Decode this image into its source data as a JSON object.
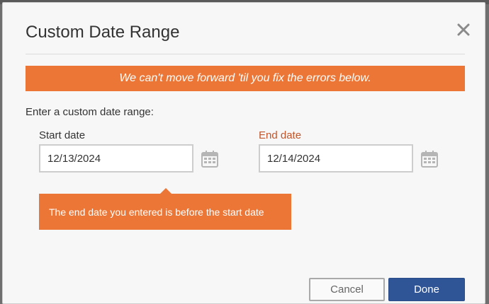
{
  "dialog": {
    "title": "Custom Date Range",
    "close_icon": "close-x-icon"
  },
  "error_banner": {
    "message": "We can't move forward 'til you fix the errors below."
  },
  "form": {
    "prompt": "Enter a custom date range:",
    "start": {
      "label": "Start date",
      "value": "12/13/2024",
      "icon": "calendar-icon"
    },
    "end": {
      "label": "End date",
      "value": "12/14/2024",
      "icon": "calendar-icon",
      "has_error": true
    }
  },
  "tooltip": {
    "message": "The end date you entered is before the start date"
  },
  "buttons": {
    "cancel": "Cancel",
    "done": "Done"
  },
  "colors": {
    "error_orange": "#ec7635",
    "error_label": "#c2552a",
    "primary_blue": "#2f5597"
  }
}
